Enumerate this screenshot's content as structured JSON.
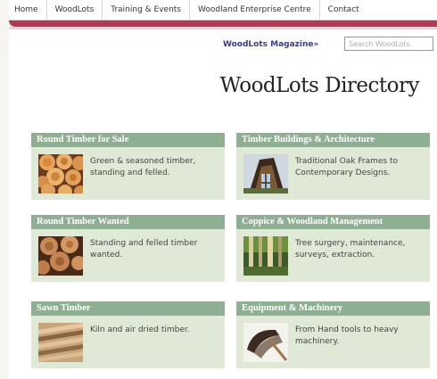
{
  "nav": {
    "items": [
      "Home",
      "WoodLots",
      "Training & Events",
      "Woodland Enterprise Centre",
      "Contact"
    ]
  },
  "magazine_link": "WoodLots Magazine",
  "magazine_arrow": "»",
  "search": {
    "placeholder": "Search WoodLots",
    "value": ""
  },
  "directory_title": "WoodLots Directory",
  "categories": [
    {
      "title": "Round Timber for Sale",
      "description": "Green & seasoned timber, standing and felled.",
      "icon": "log-pile-icon"
    },
    {
      "title": "Timber Buildings & Architecture",
      "description": "Traditional Oak Frames to Contemporary Designs.",
      "icon": "timber-building-icon"
    },
    {
      "title": "Round Timber Wanted",
      "description": "Standing and felled timber wanted.",
      "icon": "log-ends-icon"
    },
    {
      "title": "Coppice & Woodland Management",
      "description": "Tree surgery, maintenance, surveys, extraction.",
      "icon": "woodland-icon"
    },
    {
      "title": "Sawn Timber",
      "description": "Kiln and air dried timber.",
      "icon": "sawn-planks-icon"
    },
    {
      "title": "Equipment & Machinery",
      "description": "From Hand tools to heavy machinery.",
      "icon": "axe-icon"
    }
  ],
  "colors": {
    "accent_bar": "#b23a52",
    "card_header": "#8faf92",
    "card_body": "#dfe9d6",
    "magazine_link": "#3a3a8a"
  }
}
